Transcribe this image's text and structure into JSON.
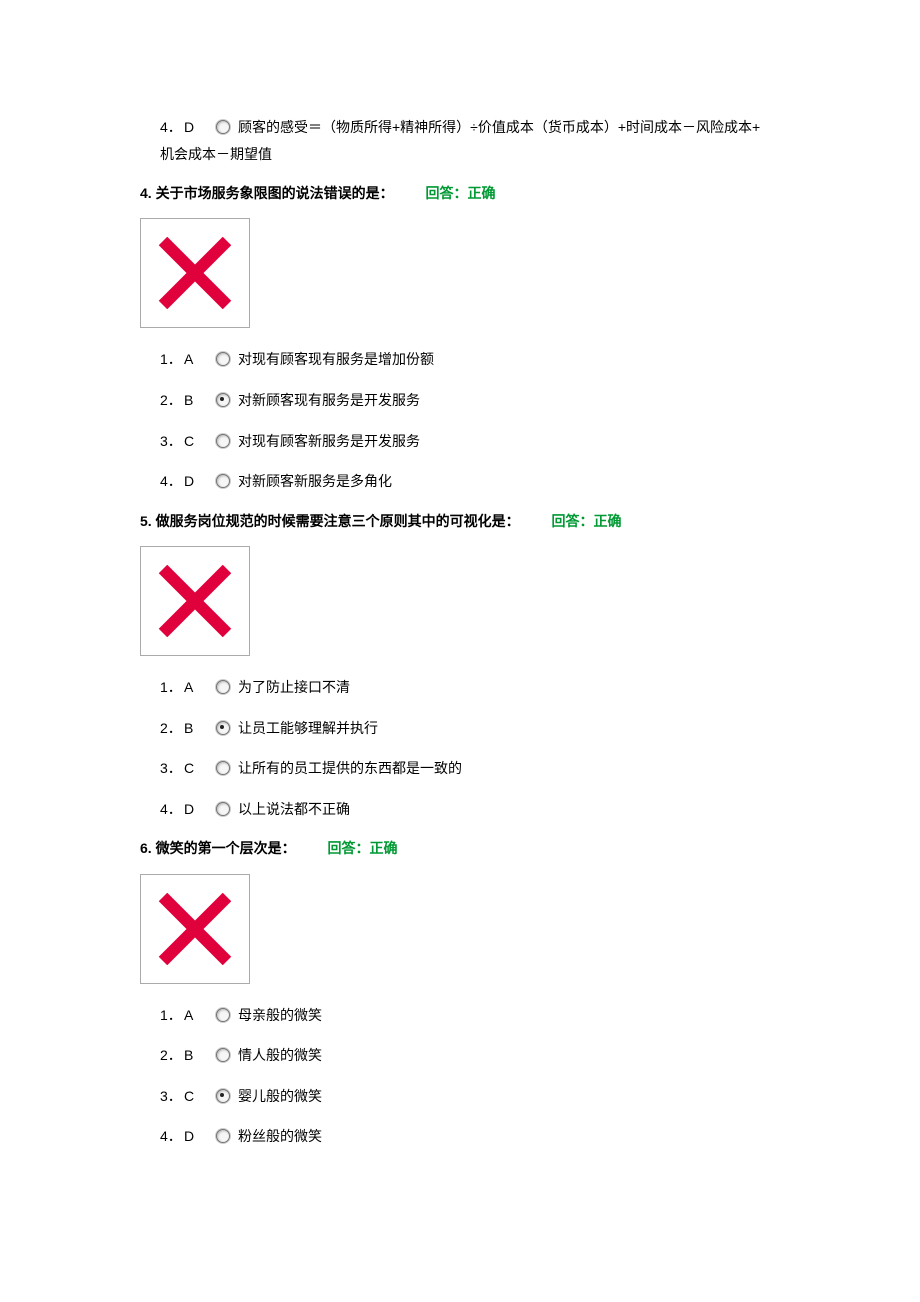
{
  "top_option": {
    "num": "4．",
    "letter": "D",
    "selected": false,
    "text_line1": "顾客的感受＝（物质所得+精神所得）÷价值成本（货币成本）+时间成本－风险成本+",
    "text_line2": "机会成本－期望值"
  },
  "questions": [
    {
      "head_prefix": "4. ",
      "head_text": "关于市场服务象限图的说法错误的是：",
      "status": "回答：正确",
      "options": [
        {
          "num": "1．",
          "letter": "A",
          "selected": false,
          "text": "对现有顾客现有服务是增加份额"
        },
        {
          "num": "2．",
          "letter": "B",
          "selected": true,
          "text": "对新顾客现有服务是开发服务"
        },
        {
          "num": "3．",
          "letter": "C",
          "selected": false,
          "text": "对现有顾客新服务是开发服务"
        },
        {
          "num": "4．",
          "letter": "D",
          "selected": false,
          "text": "对新顾客新服务是多角化"
        }
      ]
    },
    {
      "head_prefix": "5. ",
      "head_text": "做服务岗位规范的时候需要注意三个原则其中的可视化是：",
      "status": "回答：正确",
      "options": [
        {
          "num": "1．",
          "letter": "A",
          "selected": false,
          "text": "为了防止接口不清"
        },
        {
          "num": "2．",
          "letter": "B",
          "selected": true,
          "text": "让员工能够理解并执行"
        },
        {
          "num": "3．",
          "letter": "C",
          "selected": false,
          "text": "让所有的员工提供的东西都是一致的"
        },
        {
          "num": "4．",
          "letter": "D",
          "selected": false,
          "text": "以上说法都不正确"
        }
      ]
    },
    {
      "head_prefix": "6. ",
      "head_text": "微笑的第一个层次是：",
      "status": "回答：正确",
      "options": [
        {
          "num": "1．",
          "letter": "A",
          "selected": false,
          "text": "母亲般的微笑"
        },
        {
          "num": "2．",
          "letter": "B",
          "selected": false,
          "text": "情人般的微笑"
        },
        {
          "num": "3．",
          "letter": "C",
          "selected": true,
          "text": "婴儿般的微笑"
        },
        {
          "num": "4．",
          "letter": "D",
          "selected": false,
          "text": "粉丝般的微笑"
        }
      ]
    }
  ],
  "placeholder_icon": "red-x"
}
